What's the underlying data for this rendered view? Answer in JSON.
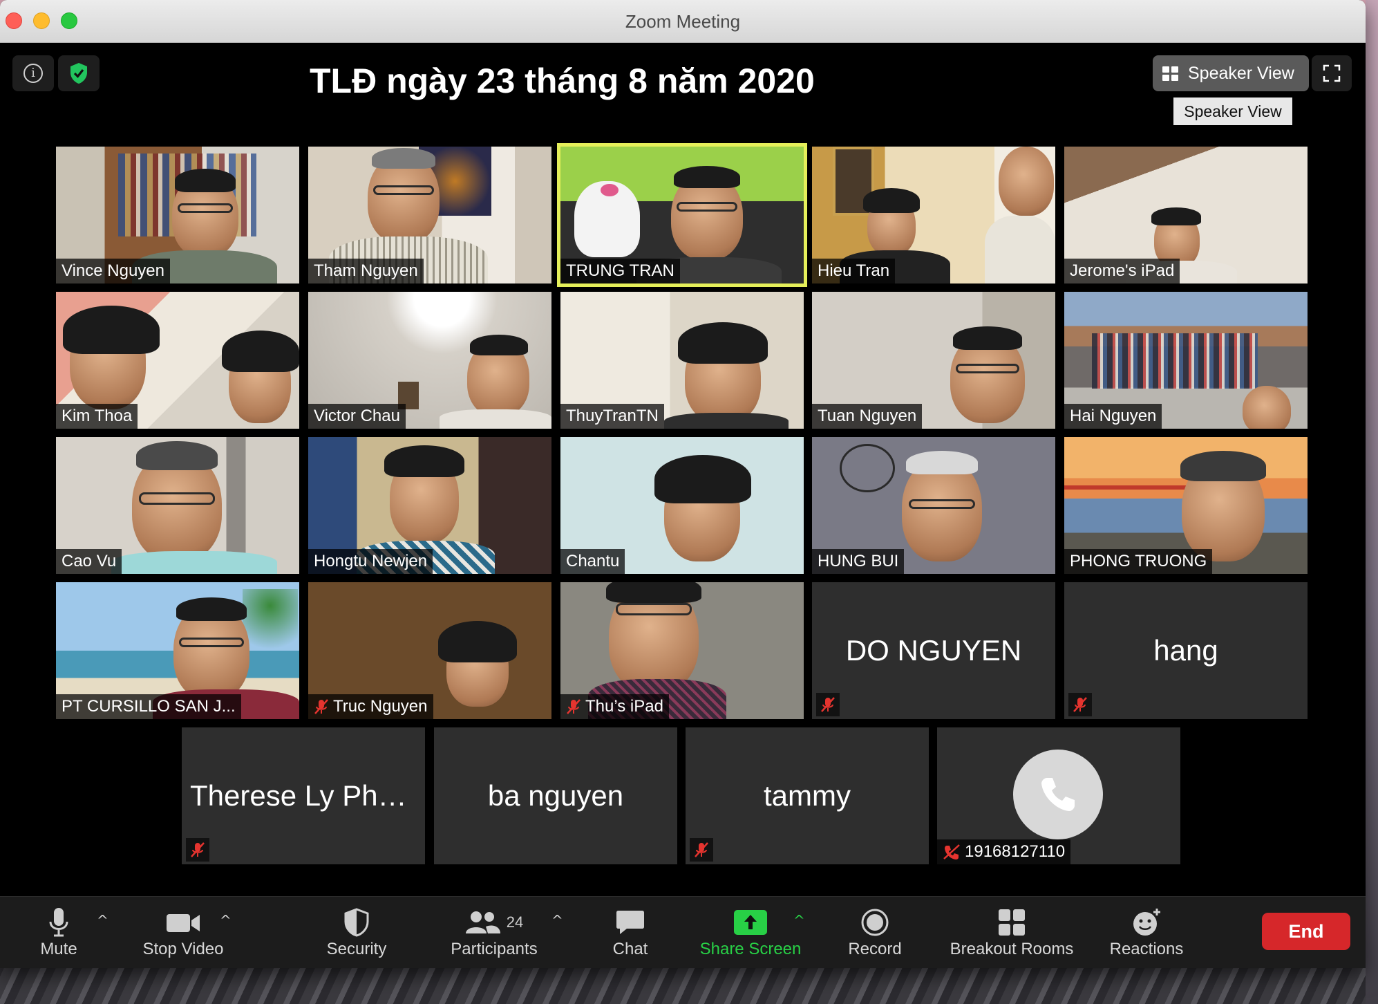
{
  "window": {
    "title": "Zoom Meeting"
  },
  "meeting_title": "TLĐ ngày 23 tháng 8 năm 2020",
  "view": {
    "button_label": "Speaker View",
    "tooltip": "Speaker View"
  },
  "participants": [
    {
      "name": "Vince Nguyen"
    },
    {
      "name": "Tham Nguyen"
    },
    {
      "name": "TRUNG TRAN"
    },
    {
      "name": "Hieu Tran"
    },
    {
      "name": "Jerome's iPad"
    },
    {
      "name": "Kim Thoa"
    },
    {
      "name": "Victor Chau"
    },
    {
      "name": "ThuyTranTN"
    },
    {
      "name": "Tuan Nguyen"
    },
    {
      "name": "Hai Nguyen"
    },
    {
      "name": "Cao Vu"
    },
    {
      "name": "Hongtu Newjen"
    },
    {
      "name": "Chantu"
    },
    {
      "name": "HUNG BUI"
    },
    {
      "name": "PHONG TRUONG"
    },
    {
      "name": "PT CURSILLO SAN J..."
    },
    {
      "name": "Truc Nguyen"
    },
    {
      "name": "Thu’s iPad"
    },
    {
      "name": "DO NGUYEN"
    },
    {
      "name": "hang"
    },
    {
      "name": "Therese Ly Phu..."
    },
    {
      "name": "ba nguyen"
    },
    {
      "name": "tammy"
    },
    {
      "name": "19168127110"
    }
  ],
  "toolbar": {
    "mute": "Mute",
    "stop_video": "Stop Video",
    "security": "Security",
    "participants": "Participants",
    "participant_count": "24",
    "chat": "Chat",
    "share_screen": "Share Screen",
    "record": "Record",
    "breakout_rooms": "Breakout Rooms",
    "reactions": "Reactions",
    "end": "End"
  },
  "colors": {
    "active_speaker_border": "#e5ef5a",
    "share_green": "#28d046",
    "end_red": "#d6272a",
    "mute_red": "#e5342f",
    "shield_green": "#22c55e"
  }
}
